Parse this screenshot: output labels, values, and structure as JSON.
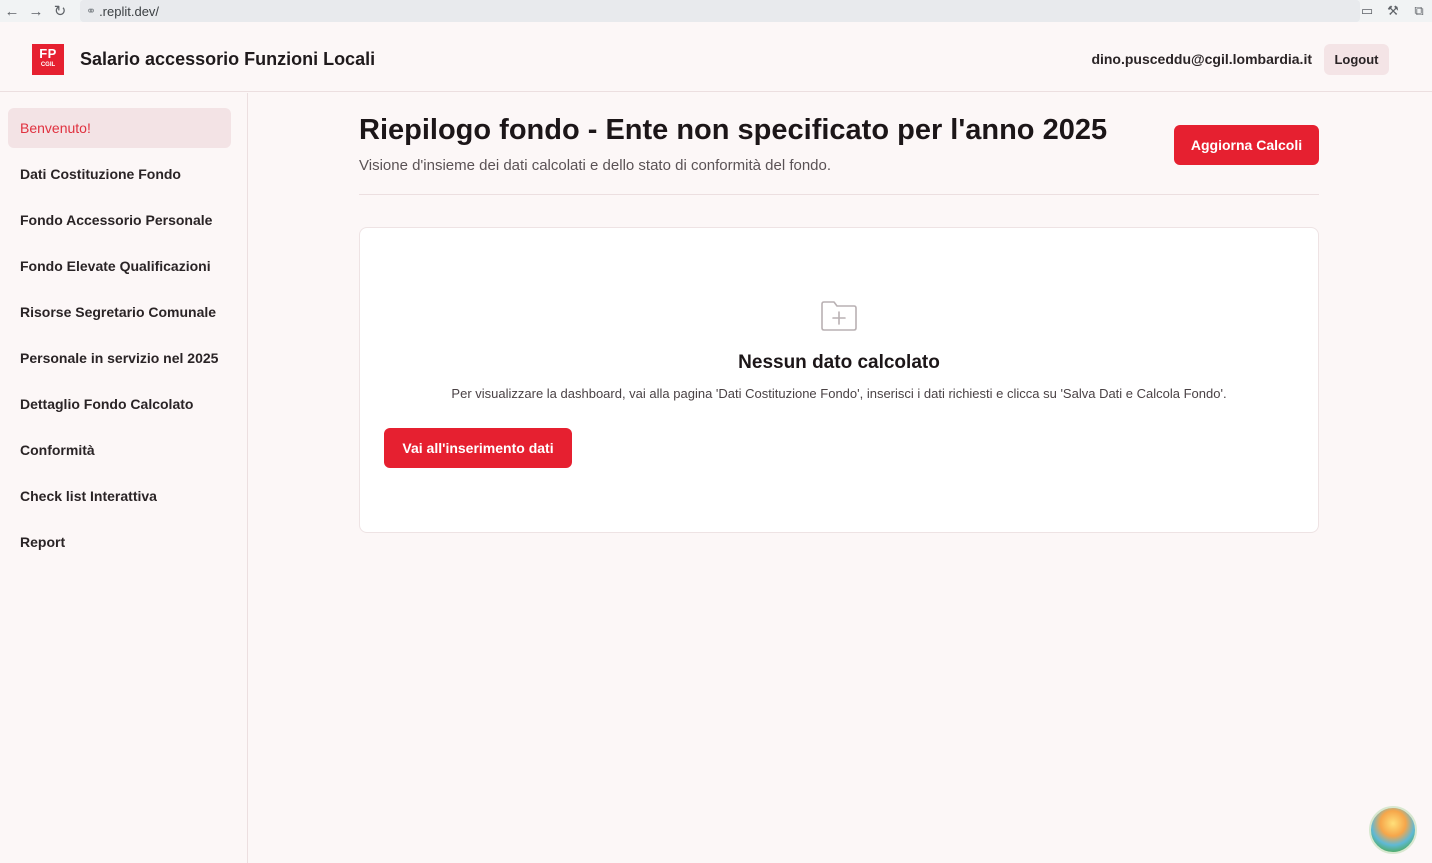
{
  "browser": {
    "url": ".replit.dev/"
  },
  "header": {
    "logo_top": "FP",
    "logo_bottom": "CGIL",
    "title": "Salario accessorio Funzioni Locali",
    "user_email": "dino.pusceddu@cgil.lombardia.it",
    "logout_label": "Logout"
  },
  "sidebar": {
    "items": [
      {
        "label": "Benvenuto!"
      },
      {
        "label": "Dati Costituzione Fondo"
      },
      {
        "label": "Fondo Accessorio Personale"
      },
      {
        "label": "Fondo Elevate Qualificazioni"
      },
      {
        "label": "Risorse Segretario Comunale"
      },
      {
        "label": "Personale in servizio nel 2025"
      },
      {
        "label": "Dettaglio Fondo Calcolato"
      },
      {
        "label": "Conformità"
      },
      {
        "label": "Check list Interattiva"
      },
      {
        "label": "Report"
      }
    ]
  },
  "main": {
    "title": "Riepilogo fondo - Ente non specificato per l'anno 2025",
    "subtitle": "Visione d'insieme dei dati calcolati e dello stato di conformità del fondo.",
    "update_button": "Aggiorna Calcoli",
    "empty_state": {
      "icon": "folder-plus-icon",
      "title": "Nessun dato calcolato",
      "text": "Per visualizzare la dashboard, vai alla pagina 'Dati Costituzione Fondo', inserisci i dati richiesti e clicca su 'Salva Dati e Calcola Fondo'.",
      "button": "Vai all'inserimento dati"
    }
  },
  "colors": {
    "accent": "#e62030",
    "active_bg": "#f3e3e5",
    "page_bg": "#fcf7f7"
  }
}
